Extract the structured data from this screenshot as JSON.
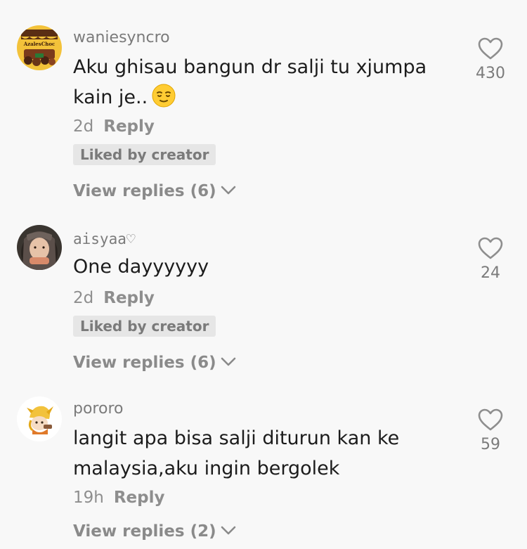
{
  "comments": [
    {
      "username": "waniesyncro",
      "avatar_label": "AzalesChoc",
      "text": "Aku ghisau bangun dr salji tu xjumpa kain je..",
      "emoji": "relieved-face-icon",
      "time": "2d",
      "reply_label": "Reply",
      "badge": "Liked by creator",
      "view_replies": "View replies (6)",
      "likes": "430"
    },
    {
      "username": "aisyaa♡",
      "text": "One dayyyyyy",
      "time": "2d",
      "reply_label": "Reply",
      "badge": "Liked by creator",
      "view_replies": "View replies (6)",
      "likes": "24"
    },
    {
      "username": "pororo",
      "text": "langit apa bisa salji diturun kan ke malaysia,aku ingin bergolek",
      "time": "19h",
      "reply_label": "Reply",
      "view_replies": "View replies (2)",
      "likes": "59"
    }
  ],
  "colors": {
    "background": "#f8f8f8",
    "text": "#1c1c1c",
    "muted": "#8e8e8e",
    "badge_bg": "#e6e6e6"
  }
}
